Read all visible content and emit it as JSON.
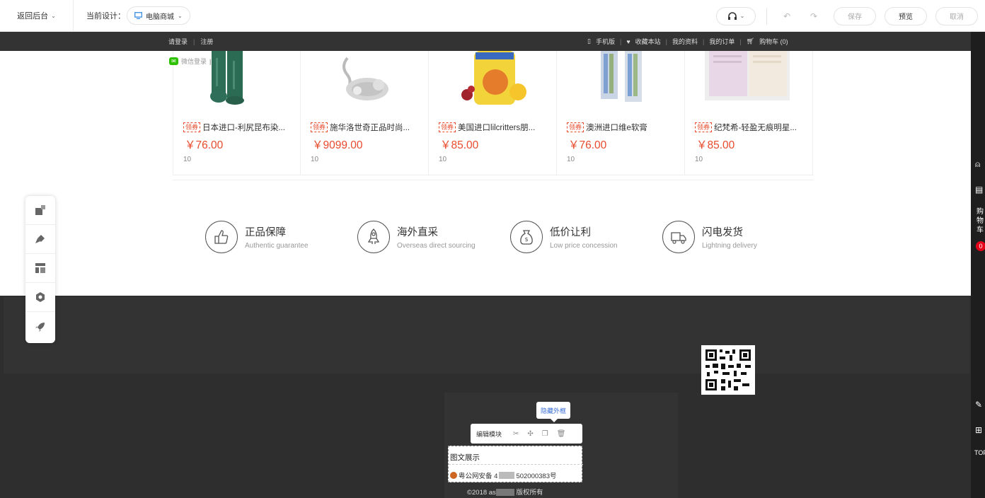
{
  "editor": {
    "back_label": "返回后台",
    "current_design_label": "当前设计：",
    "current_design_value": "电脑商城",
    "save": "保存",
    "preview": "预览",
    "cancel": "取消"
  },
  "topbar": {
    "login": "请登录",
    "register": "注册",
    "mobile": "手机版",
    "favorite": "收藏本站",
    "profile": "我的资料",
    "orders": "我的订单",
    "cart": "购物车 (0)"
  },
  "wechat_login": "微信登录",
  "coupon_tag": "领券",
  "products": [
    {
      "name": "日本进口-利尻昆布染...",
      "price": "￥76.00",
      "sales": "10",
      "image": "green-bottles"
    },
    {
      "name": "施华洛世奇正品时尚...",
      "price": "￥9099.00",
      "sales": "10",
      "image": "swan-necklace"
    },
    {
      "name": "美国进口lilcritters朋...",
      "price": "￥85.00",
      "sales": "10",
      "image": "gummy-vitamins"
    },
    {
      "name": "澳洲进口维e软膏",
      "price": "￥76.00",
      "sales": "10",
      "image": "cream-tubes"
    },
    {
      "name": "纪梵希-轻盈无痕明星...",
      "price": "￥85.00",
      "sales": "10",
      "image": "powder-compact"
    }
  ],
  "guarantees": [
    {
      "title": "正品保障",
      "subtitle": "Authentic guarantee",
      "icon": "thumbs-up-icon"
    },
    {
      "title": "海外直采",
      "subtitle": "Overseas direct sourcing",
      "icon": "rocket-icon"
    },
    {
      "title": "低价让利",
      "subtitle": "Low price concession",
      "icon": "money-bag-icon"
    },
    {
      "title": "闪电发货",
      "subtitle": "Lightning delivery",
      "icon": "truck-icon"
    }
  ],
  "right_rail": {
    "cart_label": "购物车",
    "cart_count": "0",
    "top_label": "TOP"
  },
  "module": {
    "tooltip": "隐藏外框",
    "edit_label": "编辑模块",
    "title": "图文展示",
    "icp": "粤公网安备 4",
    "icp_suffix": "502000383号",
    "copyright": "©2018 as",
    "copyright_suffix": "版权所有"
  }
}
